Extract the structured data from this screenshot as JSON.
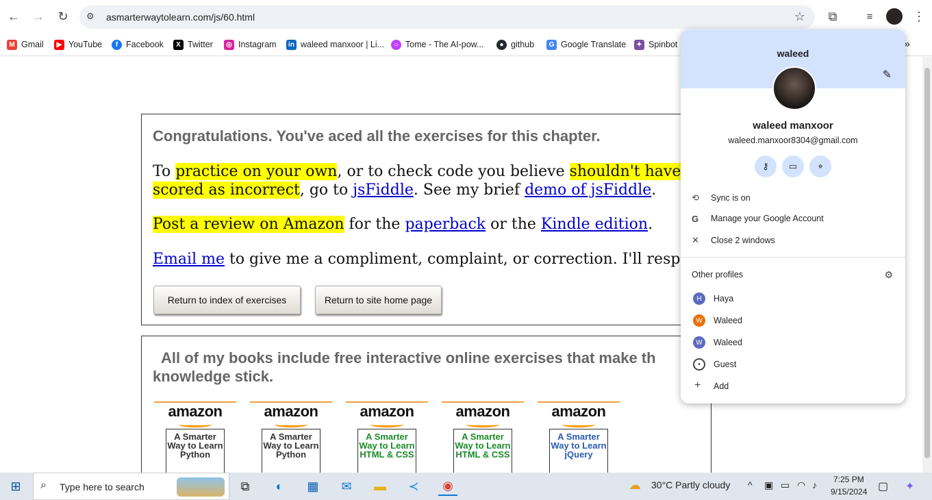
{
  "browser": {
    "url": "asmarterwaytolearn.com/js/60.html"
  },
  "bookmarks": [
    {
      "label": "Gmail",
      "color": "#ea4335",
      "glyph": "M"
    },
    {
      "label": "YouTube",
      "color": "#ff0000",
      "glyph": "▶"
    },
    {
      "label": "Facebook",
      "color": "#1877f2",
      "glyph": "f"
    },
    {
      "label": "Twitter",
      "color": "#000000",
      "glyph": "X"
    },
    {
      "label": "Instagram",
      "color": "#d6249f",
      "glyph": "◎"
    },
    {
      "label": "waleed manxoor | Li...",
      "color": "#0a66c2",
      "glyph": "in"
    },
    {
      "label": "Tome - The AI-pow...",
      "color": "#c040ff",
      "glyph": "○"
    },
    {
      "label": "github",
      "color": "#24292f",
      "glyph": "●"
    },
    {
      "label": "Google Translate",
      "color": "#4285f4",
      "glyph": "G"
    },
    {
      "label": "Spinbot",
      "color": "#7a4fa0",
      "glyph": "✦"
    }
  ],
  "page": {
    "congrats": "Congratulations. You've aced all the exercises for this chapter.",
    "p1_a": "To ",
    "p1_hl1": "practice on your own",
    "p1_b": ", or to check code you believe ",
    "p1_hl2": "shouldn't have been",
    "p1_hl3": "scored as incorrect",
    "p1_c": ", go to ",
    "p1_link1": "jsFiddle",
    "p1_d": ". See my brief ",
    "p1_link2": "demo of jsFiddle",
    "p1_e": ".",
    "p2_hl": "Post a review on Amazon",
    "p2_a": " for the ",
    "p2_link1": "paperback",
    "p2_b": " or the ",
    "p2_link2": "Kindle edition",
    "p2_c": ".",
    "p3_link": "Email me",
    "p3_a": " to give me a compliment, complaint, or correction. I'll respond",
    "btn_index": "Return to index of exercises",
    "btn_home": "Return to site home page",
    "books_heading": "All of my books include free interactive online exercises that make th",
    "books_heading2": "knowledge stick.",
    "books": [
      {
        "amazon": "amazon",
        "title": "A Smarter Way to Learn Python",
        "color": "#333333"
      },
      {
        "amazon": "amazon",
        "title": "A Smarter Way to Learn Python",
        "color": "#333333"
      },
      {
        "amazon": "amazon",
        "title": "A Smarter Way to Learn HTML & CSS",
        "color": "#1a8a2a"
      },
      {
        "amazon": "amazon",
        "title": "A Smarter Way to Learn HTML & CSS",
        "color": "#1a8a2a"
      },
      {
        "amazon": "amazon",
        "title": "A Smarter Way to Learn jQuery",
        "color": "#2a5ab0"
      }
    ]
  },
  "profile_menu": {
    "header_name": "waleed",
    "full_name": "waleed manxoor",
    "email": "waleed.manxoor8304@gmail.com",
    "sync": "Sync is on",
    "manage": "Manage your Google Account",
    "close_windows": "Close 2 windows",
    "other_profiles": "Other profiles",
    "profiles": [
      {
        "initial": "H",
        "name": "Haya",
        "color": "#5c6bc0"
      },
      {
        "initial": "W",
        "name": "Waleed",
        "color": "#e8710a"
      },
      {
        "initial": "W",
        "name": "Waleed",
        "color": "#5c6bc0"
      }
    ],
    "guest": "Guest",
    "add": "Add"
  },
  "taskbar": {
    "search_placeholder": "Type here to search",
    "weather": "30°C  Partly cloudy",
    "time": "7:25 PM",
    "date": "9/15/2024"
  }
}
